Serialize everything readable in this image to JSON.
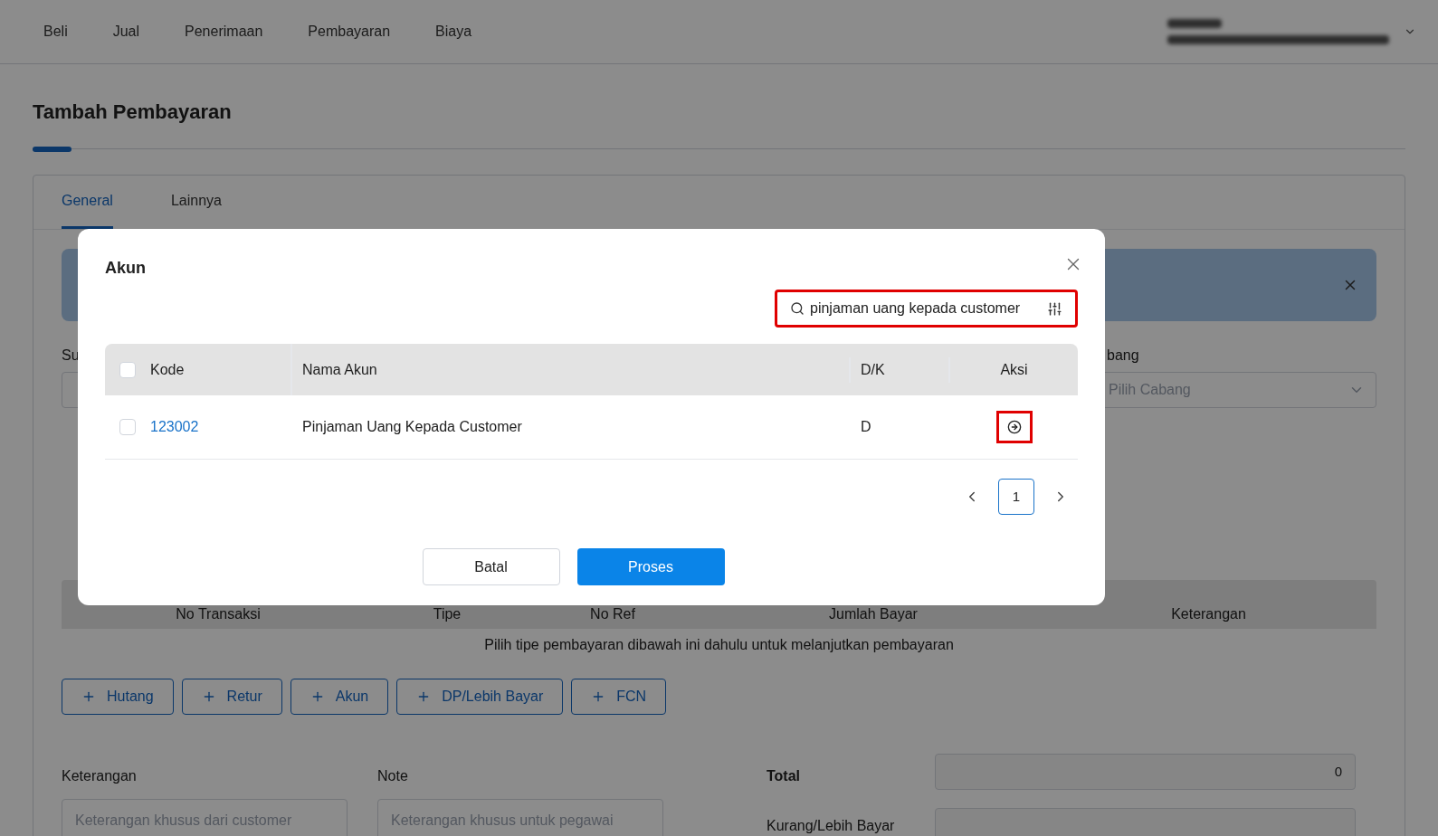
{
  "nav": {
    "items": [
      {
        "label": "Beli"
      },
      {
        "label": "Jual"
      },
      {
        "label": "Penerimaan"
      },
      {
        "label": "Pembayaran"
      },
      {
        "label": "Biaya"
      }
    ]
  },
  "page": {
    "title": "Tambah Pembayaran",
    "tabs": [
      {
        "label": "General",
        "selected": true
      },
      {
        "label": "Lainnya",
        "selected": false
      }
    ],
    "form_labels": {
      "left": "Su",
      "right": "bang"
    },
    "branch_placeholder": "Pilih Cabang",
    "payment_table": {
      "columns": [
        "No Transaksi",
        "Tipe",
        "No Ref",
        "Jumlah Bayar",
        "Keterangan"
      ],
      "hint": "Pilih tipe pembayaran dibawah ini dahulu untuk melanjutkan pembayaran"
    },
    "add_buttons": [
      "Hutang",
      "Retur",
      "Akun",
      "DP/Lebih Bayar",
      "FCN"
    ],
    "keterangan": {
      "label": "Keterangan",
      "placeholder": "Keterangan khusus dari customer"
    },
    "note": {
      "label": "Note",
      "placeholder": "Keterangan khusus untuk pegawai"
    },
    "total": {
      "label": "Total",
      "value": "0"
    },
    "kurang_lebih": {
      "label": "Kurang/Lebih Bayar"
    }
  },
  "modal": {
    "title": "Akun",
    "search": {
      "value": "pinjaman uang kepada customer",
      "highlighted": true
    },
    "columns": [
      "Kode",
      "Nama Akun",
      "D/K",
      "Aksi"
    ],
    "select_all_checked": false,
    "rows": [
      {
        "code": "123002",
        "name": "Pinjaman Uang Kepada Customer",
        "dk": "D",
        "checked": false,
        "action_highlighted": true
      }
    ],
    "pages": [
      {
        "label": "1",
        "selected": true
      }
    ],
    "buttons": {
      "cancel": "Batal",
      "submit": "Proses"
    }
  }
}
